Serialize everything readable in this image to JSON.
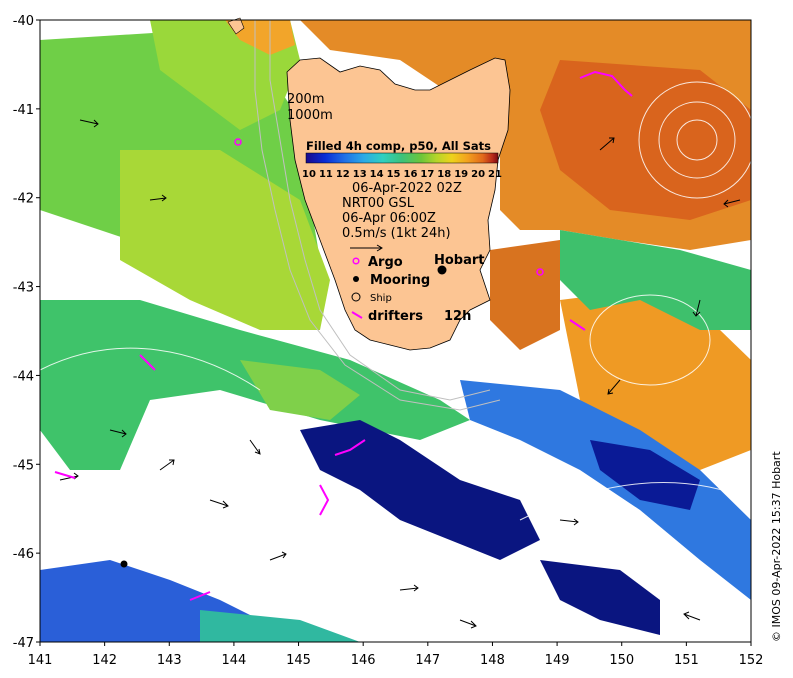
{
  "map": {
    "lon_range": [
      141,
      152
    ],
    "lat_range": [
      -47,
      -40
    ],
    "x_ticks": [
      "141",
      "142",
      "143",
      "144",
      "145",
      "146",
      "147",
      "148",
      "149",
      "150",
      "151",
      "152"
    ],
    "y_ticks": [
      "-40",
      "-41",
      "-42",
      "-43",
      "-44",
      "-45",
      "-46",
      "-47"
    ]
  },
  "depth_labels": {
    "d200": "200m",
    "d1000": "1000m"
  },
  "colorbar": {
    "title": "Filled 4h comp, p50, All Sats",
    "ticks": [
      "10",
      "11",
      "12",
      "13",
      "14",
      "15",
      "16",
      "17",
      "18",
      "19",
      "20",
      "21"
    ],
    "colors": [
      "#1a0a8c",
      "#0a2dd6",
      "#1f6fe6",
      "#2aa9e6",
      "#2fd0c0",
      "#3cc27a",
      "#6dc63a",
      "#b5d52a",
      "#eed21c",
      "#f3a21f",
      "#e2691b",
      "#b82a1a",
      "#7a0a12"
    ]
  },
  "legend": {
    "date": "06-Apr-2022 02Z",
    "model": "NRT00 GSL",
    "model_time": "06-Apr 06:00Z",
    "speed": "0.5m/s (1kt 24h)",
    "argo": "Argo",
    "mooring": "Mooring",
    "ship": "Ship",
    "drifters": "drifters",
    "drifters_window": "12h"
  },
  "place": {
    "hobart": "Hobart"
  },
  "credit": "© IMOS 09-Apr-2022 15:37 Hobart",
  "colors": {
    "land": "#fcc593",
    "argo": "#ff00ff",
    "drifter": "#ff00ff",
    "contour": "#ffffff"
  }
}
